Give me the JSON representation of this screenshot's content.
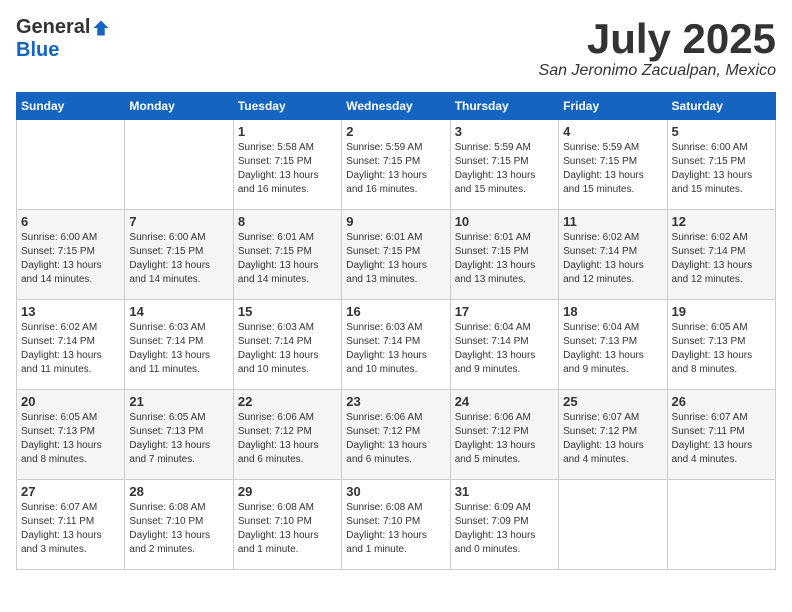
{
  "logo": {
    "general": "General",
    "blue": "Blue"
  },
  "title": {
    "month_year": "July 2025",
    "location": "San Jeronimo Zacualpan, Mexico"
  },
  "weekdays": [
    "Sunday",
    "Monday",
    "Tuesday",
    "Wednesday",
    "Thursday",
    "Friday",
    "Saturday"
  ],
  "weeks": [
    [
      {
        "day": "",
        "info": ""
      },
      {
        "day": "",
        "info": ""
      },
      {
        "day": "1",
        "info": "Sunrise: 5:58 AM\nSunset: 7:15 PM\nDaylight: 13 hours\nand 16 minutes."
      },
      {
        "day": "2",
        "info": "Sunrise: 5:59 AM\nSunset: 7:15 PM\nDaylight: 13 hours\nand 16 minutes."
      },
      {
        "day": "3",
        "info": "Sunrise: 5:59 AM\nSunset: 7:15 PM\nDaylight: 13 hours\nand 15 minutes."
      },
      {
        "day": "4",
        "info": "Sunrise: 5:59 AM\nSunset: 7:15 PM\nDaylight: 13 hours\nand 15 minutes."
      },
      {
        "day": "5",
        "info": "Sunrise: 6:00 AM\nSunset: 7:15 PM\nDaylight: 13 hours\nand 15 minutes."
      }
    ],
    [
      {
        "day": "6",
        "info": "Sunrise: 6:00 AM\nSunset: 7:15 PM\nDaylight: 13 hours\nand 14 minutes."
      },
      {
        "day": "7",
        "info": "Sunrise: 6:00 AM\nSunset: 7:15 PM\nDaylight: 13 hours\nand 14 minutes."
      },
      {
        "day": "8",
        "info": "Sunrise: 6:01 AM\nSunset: 7:15 PM\nDaylight: 13 hours\nand 14 minutes."
      },
      {
        "day": "9",
        "info": "Sunrise: 6:01 AM\nSunset: 7:15 PM\nDaylight: 13 hours\nand 13 minutes."
      },
      {
        "day": "10",
        "info": "Sunrise: 6:01 AM\nSunset: 7:15 PM\nDaylight: 13 hours\nand 13 minutes."
      },
      {
        "day": "11",
        "info": "Sunrise: 6:02 AM\nSunset: 7:14 PM\nDaylight: 13 hours\nand 12 minutes."
      },
      {
        "day": "12",
        "info": "Sunrise: 6:02 AM\nSunset: 7:14 PM\nDaylight: 13 hours\nand 12 minutes."
      }
    ],
    [
      {
        "day": "13",
        "info": "Sunrise: 6:02 AM\nSunset: 7:14 PM\nDaylight: 13 hours\nand 11 minutes."
      },
      {
        "day": "14",
        "info": "Sunrise: 6:03 AM\nSunset: 7:14 PM\nDaylight: 13 hours\nand 11 minutes."
      },
      {
        "day": "15",
        "info": "Sunrise: 6:03 AM\nSunset: 7:14 PM\nDaylight: 13 hours\nand 10 minutes."
      },
      {
        "day": "16",
        "info": "Sunrise: 6:03 AM\nSunset: 7:14 PM\nDaylight: 13 hours\nand 10 minutes."
      },
      {
        "day": "17",
        "info": "Sunrise: 6:04 AM\nSunset: 7:14 PM\nDaylight: 13 hours\nand 9 minutes."
      },
      {
        "day": "18",
        "info": "Sunrise: 6:04 AM\nSunset: 7:13 PM\nDaylight: 13 hours\nand 9 minutes."
      },
      {
        "day": "19",
        "info": "Sunrise: 6:05 AM\nSunset: 7:13 PM\nDaylight: 13 hours\nand 8 minutes."
      }
    ],
    [
      {
        "day": "20",
        "info": "Sunrise: 6:05 AM\nSunset: 7:13 PM\nDaylight: 13 hours\nand 8 minutes."
      },
      {
        "day": "21",
        "info": "Sunrise: 6:05 AM\nSunset: 7:13 PM\nDaylight: 13 hours\nand 7 minutes."
      },
      {
        "day": "22",
        "info": "Sunrise: 6:06 AM\nSunset: 7:12 PM\nDaylight: 13 hours\nand 6 minutes."
      },
      {
        "day": "23",
        "info": "Sunrise: 6:06 AM\nSunset: 7:12 PM\nDaylight: 13 hours\nand 6 minutes."
      },
      {
        "day": "24",
        "info": "Sunrise: 6:06 AM\nSunset: 7:12 PM\nDaylight: 13 hours\nand 5 minutes."
      },
      {
        "day": "25",
        "info": "Sunrise: 6:07 AM\nSunset: 7:12 PM\nDaylight: 13 hours\nand 4 minutes."
      },
      {
        "day": "26",
        "info": "Sunrise: 6:07 AM\nSunset: 7:11 PM\nDaylight: 13 hours\nand 4 minutes."
      }
    ],
    [
      {
        "day": "27",
        "info": "Sunrise: 6:07 AM\nSunset: 7:11 PM\nDaylight: 13 hours\nand 3 minutes."
      },
      {
        "day": "28",
        "info": "Sunrise: 6:08 AM\nSunset: 7:10 PM\nDaylight: 13 hours\nand 2 minutes."
      },
      {
        "day": "29",
        "info": "Sunrise: 6:08 AM\nSunset: 7:10 PM\nDaylight: 13 hours\nand 1 minute."
      },
      {
        "day": "30",
        "info": "Sunrise: 6:08 AM\nSunset: 7:10 PM\nDaylight: 13 hours\nand 1 minute."
      },
      {
        "day": "31",
        "info": "Sunrise: 6:09 AM\nSunset: 7:09 PM\nDaylight: 13 hours\nand 0 minutes."
      },
      {
        "day": "",
        "info": ""
      },
      {
        "day": "",
        "info": ""
      }
    ]
  ]
}
